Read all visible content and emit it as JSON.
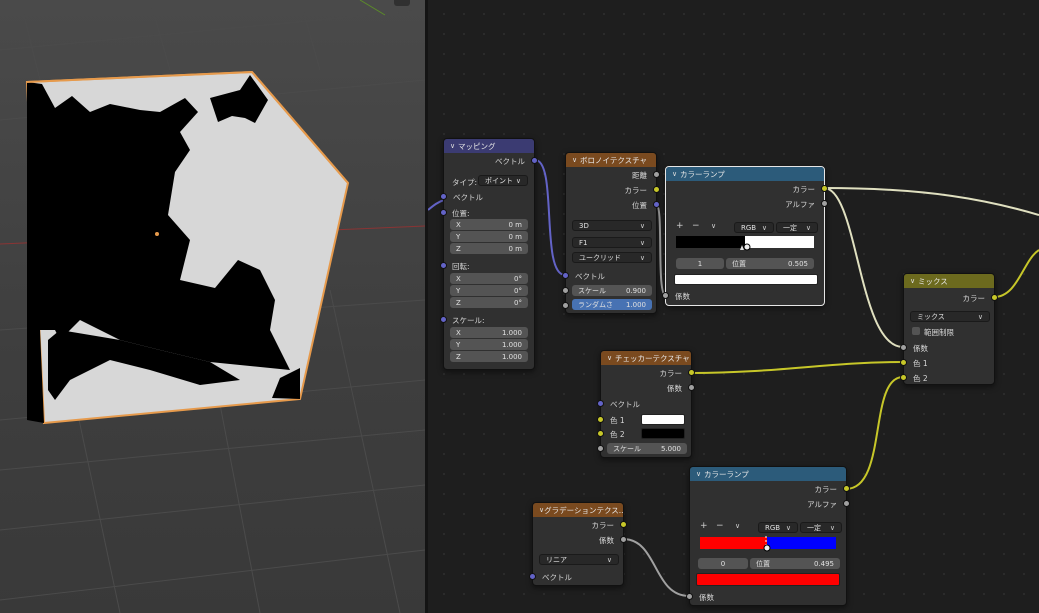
{
  "colors": {
    "vector_header": "#3b3b72",
    "texture_header": "#7a4a1f",
    "converter_header": "#2c5b7a",
    "color_header": "#6c6a1e",
    "socket_grey": "#a1a1a1",
    "socket_yellow": "#c7c729",
    "socket_purple": "#6363c7",
    "selection_outline": "#e69a4c"
  },
  "icons": {
    "collapse": "chevron-down-icon",
    "dropdown": "chevron-down-icon",
    "add": "plus-icon",
    "remove": "minus-icon",
    "viewport_menu": "grid-icon"
  },
  "glyphs": {
    "chevron": "∨",
    "plus": "+",
    "minus": "−"
  },
  "mapping": {
    "title": "マッピング",
    "out_vector": "ベクトル",
    "type_label": "タイプ:",
    "type_value": "ポイント",
    "in_vector": "ベクトル",
    "location_label": "位置:",
    "location": [
      {
        "axis": "X",
        "value": "0 m"
      },
      {
        "axis": "Y",
        "value": "0 m"
      },
      {
        "axis": "Z",
        "value": "0 m"
      }
    ],
    "rotation_label": "回転:",
    "rotation": [
      {
        "axis": "X",
        "value": "0°"
      },
      {
        "axis": "Y",
        "value": "0°"
      },
      {
        "axis": "Z",
        "value": "0°"
      }
    ],
    "scale_label": "スケール:",
    "scale": [
      {
        "axis": "X",
        "value": "1.000"
      },
      {
        "axis": "Y",
        "value": "1.000"
      },
      {
        "axis": "Z",
        "value": "1.000"
      }
    ]
  },
  "voronoi": {
    "title": "ボロノイテクスチャ",
    "out_distance": "距離",
    "out_color": "カラー",
    "out_position": "位置",
    "dim": "3D",
    "feature": "F1",
    "metric": "ユークリッド",
    "in_vector": "ベクトル",
    "scale_label": "スケール",
    "scale_value": "0.900",
    "random_label": "ランダムさ",
    "random_value": "1.000"
  },
  "ramp1": {
    "title": "カラーランプ",
    "out_color": "カラー",
    "out_alpha": "アルファ",
    "mode": "RGB",
    "interp": "一定",
    "index": "1",
    "pos_label": "位置",
    "pos_value": "0.505",
    "stops": [
      {
        "pos": 0.0,
        "color": "#000000"
      },
      {
        "pos": 0.505,
        "color": "#ffffff"
      }
    ],
    "active_color": "#ffffff",
    "in_fac": "係数"
  },
  "checker": {
    "title": "チェッカーテクスチャ",
    "out_color": "カラー",
    "out_fac": "係数",
    "in_vector": "ベクトル",
    "color1_label": "色 1",
    "color1": "#ffffff",
    "color2_label": "色 2",
    "color2": "#000000",
    "scale_label": "スケール",
    "scale_value": "5.000"
  },
  "mix": {
    "title": "ミックス",
    "out_color": "カラー",
    "blend": "ミックス",
    "clamp_label": "範囲制限",
    "in_fac": "係数",
    "in_color1": "色 1",
    "in_color2": "色 2"
  },
  "ramp2": {
    "title": "カラーランプ",
    "out_color": "カラー",
    "out_alpha": "アルファ",
    "mode": "RGB",
    "interp": "一定",
    "index": "0",
    "pos_label": "位置",
    "pos_value": "0.495",
    "stops": [
      {
        "pos": 0.0,
        "color": "#ff0000"
      },
      {
        "pos": 0.495,
        "color": "#0000ff"
      }
    ],
    "active_color": "#ff0000",
    "in_fac": "係数"
  },
  "gradient": {
    "title": "グラデーションテクス...",
    "out_color": "カラー",
    "out_fac": "係数",
    "type": "リニア",
    "in_vector": "ベクトル"
  }
}
